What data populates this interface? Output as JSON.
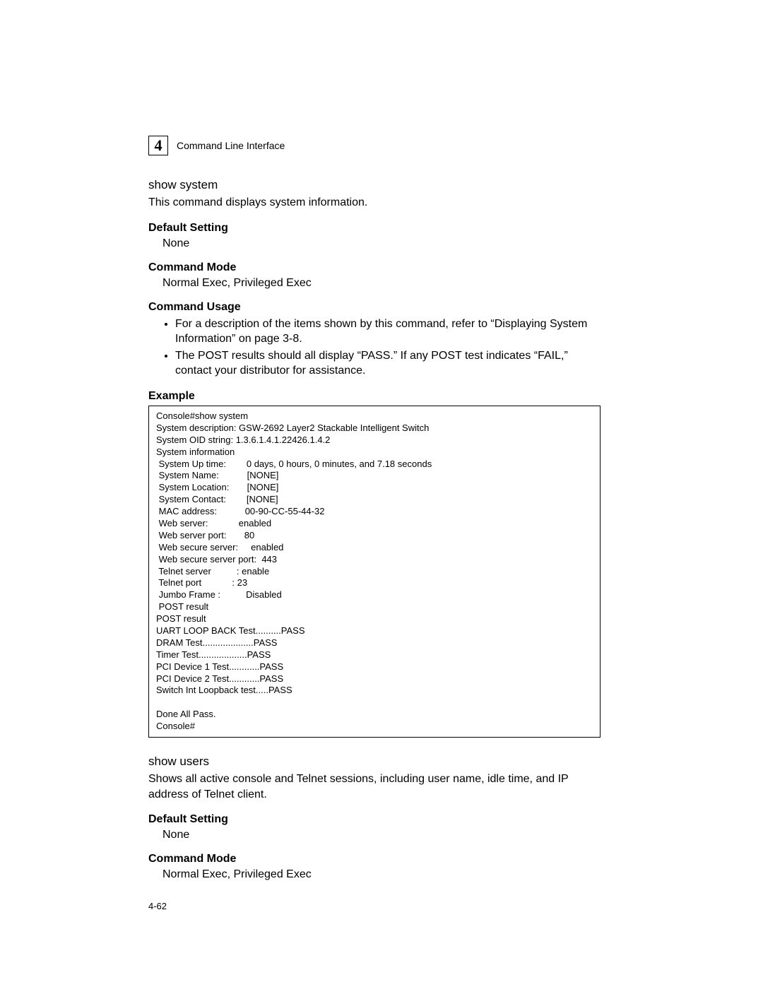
{
  "chapter_number": "4",
  "header_title": "Command Line Interface",
  "section1": {
    "cmd": "show system",
    "desc": "This command displays system information.",
    "default_setting_head": "Default Setting",
    "default_setting_body": "None",
    "command_mode_head": "Command Mode",
    "command_mode_body": "Normal Exec, Privileged Exec",
    "command_usage_head": "Command Usage",
    "usage_bullet1": "For a description of the items shown by this command, refer to “Displaying System Information” on page 3-8.",
    "usage_bullet2": "The POST results should all display “PASS.” If any POST test indicates “FAIL,” contact your distributor for assistance.",
    "example_head": "Example",
    "example_body": "Console#show system\nSystem description: GSW-2692 Layer2 Stackable Intelligent Switch\nSystem OID string: 1.3.6.1.4.1.22426.1.4.2\nSystem information\n System Up time:        0 days, 0 hours, 0 minutes, and 7.18 seconds\n System Name:           [NONE]\n System Location:       [NONE]\n System Contact:        [NONE]\n MAC address:           00-90-CC-55-44-32\n Web server:            enabled\n Web server port:       80\n Web secure server:     enabled\n Web secure server port:  443\n Telnet server          : enable\n Telnet port            : 23\n Jumbo Frame :          Disabled\n POST result\nPOST result\nUART LOOP BACK Test..........PASS\nDRAM Test....................PASS\nTimer Test...................PASS\nPCI Device 1 Test............PASS\nPCI Device 2 Test............PASS\nSwitch Int Loopback test.....PASS\n\nDone All Pass.\nConsole#"
  },
  "section2": {
    "cmd": "show users",
    "desc": "Shows all active console and Telnet sessions, including user name, idle time, and IP address of Telnet client.",
    "default_setting_head": "Default Setting",
    "default_setting_body": "None",
    "command_mode_head": "Command Mode",
    "command_mode_body": "Normal Exec, Privileged Exec"
  },
  "page_number": "4-62"
}
